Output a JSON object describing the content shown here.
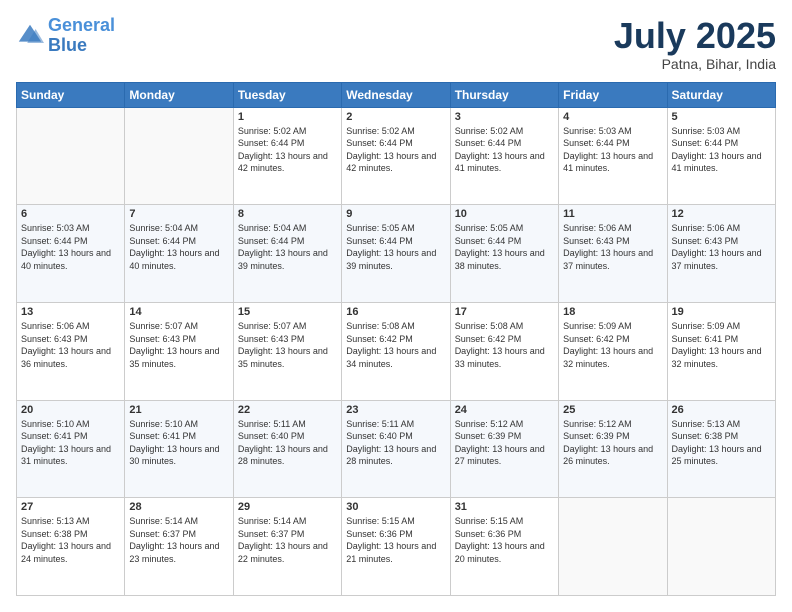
{
  "logo": {
    "line1": "General",
    "line2": "Blue"
  },
  "title": "July 2025",
  "location": "Patna, Bihar, India",
  "days_header": [
    "Sunday",
    "Monday",
    "Tuesday",
    "Wednesday",
    "Thursday",
    "Friday",
    "Saturday"
  ],
  "weeks": [
    [
      {
        "day": "",
        "sunrise": "",
        "sunset": "",
        "daylight": ""
      },
      {
        "day": "",
        "sunrise": "",
        "sunset": "",
        "daylight": ""
      },
      {
        "day": "1",
        "sunrise": "Sunrise: 5:02 AM",
        "sunset": "Sunset: 6:44 PM",
        "daylight": "Daylight: 13 hours and 42 minutes."
      },
      {
        "day": "2",
        "sunrise": "Sunrise: 5:02 AM",
        "sunset": "Sunset: 6:44 PM",
        "daylight": "Daylight: 13 hours and 42 minutes."
      },
      {
        "day": "3",
        "sunrise": "Sunrise: 5:02 AM",
        "sunset": "Sunset: 6:44 PM",
        "daylight": "Daylight: 13 hours and 41 minutes."
      },
      {
        "day": "4",
        "sunrise": "Sunrise: 5:03 AM",
        "sunset": "Sunset: 6:44 PM",
        "daylight": "Daylight: 13 hours and 41 minutes."
      },
      {
        "day": "5",
        "sunrise": "Sunrise: 5:03 AM",
        "sunset": "Sunset: 6:44 PM",
        "daylight": "Daylight: 13 hours and 41 minutes."
      }
    ],
    [
      {
        "day": "6",
        "sunrise": "Sunrise: 5:03 AM",
        "sunset": "Sunset: 6:44 PM",
        "daylight": "Daylight: 13 hours and 40 minutes."
      },
      {
        "day": "7",
        "sunrise": "Sunrise: 5:04 AM",
        "sunset": "Sunset: 6:44 PM",
        "daylight": "Daylight: 13 hours and 40 minutes."
      },
      {
        "day": "8",
        "sunrise": "Sunrise: 5:04 AM",
        "sunset": "Sunset: 6:44 PM",
        "daylight": "Daylight: 13 hours and 39 minutes."
      },
      {
        "day": "9",
        "sunrise": "Sunrise: 5:05 AM",
        "sunset": "Sunset: 6:44 PM",
        "daylight": "Daylight: 13 hours and 39 minutes."
      },
      {
        "day": "10",
        "sunrise": "Sunrise: 5:05 AM",
        "sunset": "Sunset: 6:44 PM",
        "daylight": "Daylight: 13 hours and 38 minutes."
      },
      {
        "day": "11",
        "sunrise": "Sunrise: 5:06 AM",
        "sunset": "Sunset: 6:43 PM",
        "daylight": "Daylight: 13 hours and 37 minutes."
      },
      {
        "day": "12",
        "sunrise": "Sunrise: 5:06 AM",
        "sunset": "Sunset: 6:43 PM",
        "daylight": "Daylight: 13 hours and 37 minutes."
      }
    ],
    [
      {
        "day": "13",
        "sunrise": "Sunrise: 5:06 AM",
        "sunset": "Sunset: 6:43 PM",
        "daylight": "Daylight: 13 hours and 36 minutes."
      },
      {
        "day": "14",
        "sunrise": "Sunrise: 5:07 AM",
        "sunset": "Sunset: 6:43 PM",
        "daylight": "Daylight: 13 hours and 35 minutes."
      },
      {
        "day": "15",
        "sunrise": "Sunrise: 5:07 AM",
        "sunset": "Sunset: 6:43 PM",
        "daylight": "Daylight: 13 hours and 35 minutes."
      },
      {
        "day": "16",
        "sunrise": "Sunrise: 5:08 AM",
        "sunset": "Sunset: 6:42 PM",
        "daylight": "Daylight: 13 hours and 34 minutes."
      },
      {
        "day": "17",
        "sunrise": "Sunrise: 5:08 AM",
        "sunset": "Sunset: 6:42 PM",
        "daylight": "Daylight: 13 hours and 33 minutes."
      },
      {
        "day": "18",
        "sunrise": "Sunrise: 5:09 AM",
        "sunset": "Sunset: 6:42 PM",
        "daylight": "Daylight: 13 hours and 32 minutes."
      },
      {
        "day": "19",
        "sunrise": "Sunrise: 5:09 AM",
        "sunset": "Sunset: 6:41 PM",
        "daylight": "Daylight: 13 hours and 32 minutes."
      }
    ],
    [
      {
        "day": "20",
        "sunrise": "Sunrise: 5:10 AM",
        "sunset": "Sunset: 6:41 PM",
        "daylight": "Daylight: 13 hours and 31 minutes."
      },
      {
        "day": "21",
        "sunrise": "Sunrise: 5:10 AM",
        "sunset": "Sunset: 6:41 PM",
        "daylight": "Daylight: 13 hours and 30 minutes."
      },
      {
        "day": "22",
        "sunrise": "Sunrise: 5:11 AM",
        "sunset": "Sunset: 6:40 PM",
        "daylight": "Daylight: 13 hours and 28 minutes."
      },
      {
        "day": "23",
        "sunrise": "Sunrise: 5:11 AM",
        "sunset": "Sunset: 6:40 PM",
        "daylight": "Daylight: 13 hours and 28 minutes."
      },
      {
        "day": "24",
        "sunrise": "Sunrise: 5:12 AM",
        "sunset": "Sunset: 6:39 PM",
        "daylight": "Daylight: 13 hours and 27 minutes."
      },
      {
        "day": "25",
        "sunrise": "Sunrise: 5:12 AM",
        "sunset": "Sunset: 6:39 PM",
        "daylight": "Daylight: 13 hours and 26 minutes."
      },
      {
        "day": "26",
        "sunrise": "Sunrise: 5:13 AM",
        "sunset": "Sunset: 6:38 PM",
        "daylight": "Daylight: 13 hours and 25 minutes."
      }
    ],
    [
      {
        "day": "27",
        "sunrise": "Sunrise: 5:13 AM",
        "sunset": "Sunset: 6:38 PM",
        "daylight": "Daylight: 13 hours and 24 minutes."
      },
      {
        "day": "28",
        "sunrise": "Sunrise: 5:14 AM",
        "sunset": "Sunset: 6:37 PM",
        "daylight": "Daylight: 13 hours and 23 minutes."
      },
      {
        "day": "29",
        "sunrise": "Sunrise: 5:14 AM",
        "sunset": "Sunset: 6:37 PM",
        "daylight": "Daylight: 13 hours and 22 minutes."
      },
      {
        "day": "30",
        "sunrise": "Sunrise: 5:15 AM",
        "sunset": "Sunset: 6:36 PM",
        "daylight": "Daylight: 13 hours and 21 minutes."
      },
      {
        "day": "31",
        "sunrise": "Sunrise: 5:15 AM",
        "sunset": "Sunset: 6:36 PM",
        "daylight": "Daylight: 13 hours and 20 minutes."
      },
      {
        "day": "",
        "sunrise": "",
        "sunset": "",
        "daylight": ""
      },
      {
        "day": "",
        "sunrise": "",
        "sunset": "",
        "daylight": ""
      }
    ]
  ]
}
